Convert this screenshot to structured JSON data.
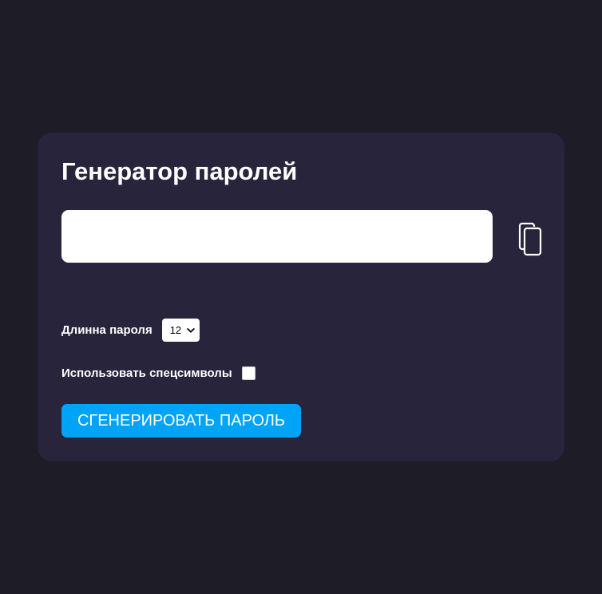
{
  "app": {
    "title": "Генератор паролей"
  },
  "password": {
    "value": "",
    "placeholder": ""
  },
  "copy_button": {
    "icon": "copy-icon"
  },
  "length": {
    "label": "Длинна пароля",
    "selected": "12",
    "dropdown_icon": "chevron-down-icon"
  },
  "special_chars": {
    "label": "Использовать спецсимволы",
    "checked": false
  },
  "generate": {
    "label": "СГЕНЕРИРОВАТЬ ПАРОЛЬ"
  },
  "colors": {
    "page_background": "#1e1c26",
    "card_background": "#27243b",
    "accent": "#00a4f6",
    "text": "#ffffff"
  }
}
